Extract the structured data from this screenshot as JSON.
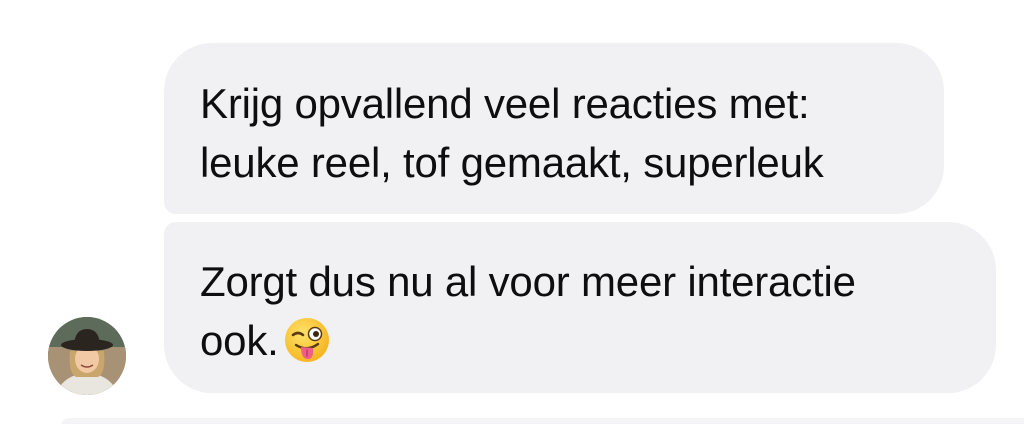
{
  "messages": [
    {
      "lines": [
        "Krijg opvallend veel reacties met:",
        "leuke reel, tof gemaakt, superleuk"
      ]
    },
    {
      "lines": [
        "Zorgt dus nu al voor meer interactie",
        "ook."
      ],
      "emoji": "winking-face-with-tongue"
    }
  ],
  "sender": {
    "avatar_icon": "person-with-hat-avatar"
  },
  "colors": {
    "bubble_background": "#f1f1f3",
    "text": "#0e0e10",
    "page_background": "#ffffff"
  }
}
